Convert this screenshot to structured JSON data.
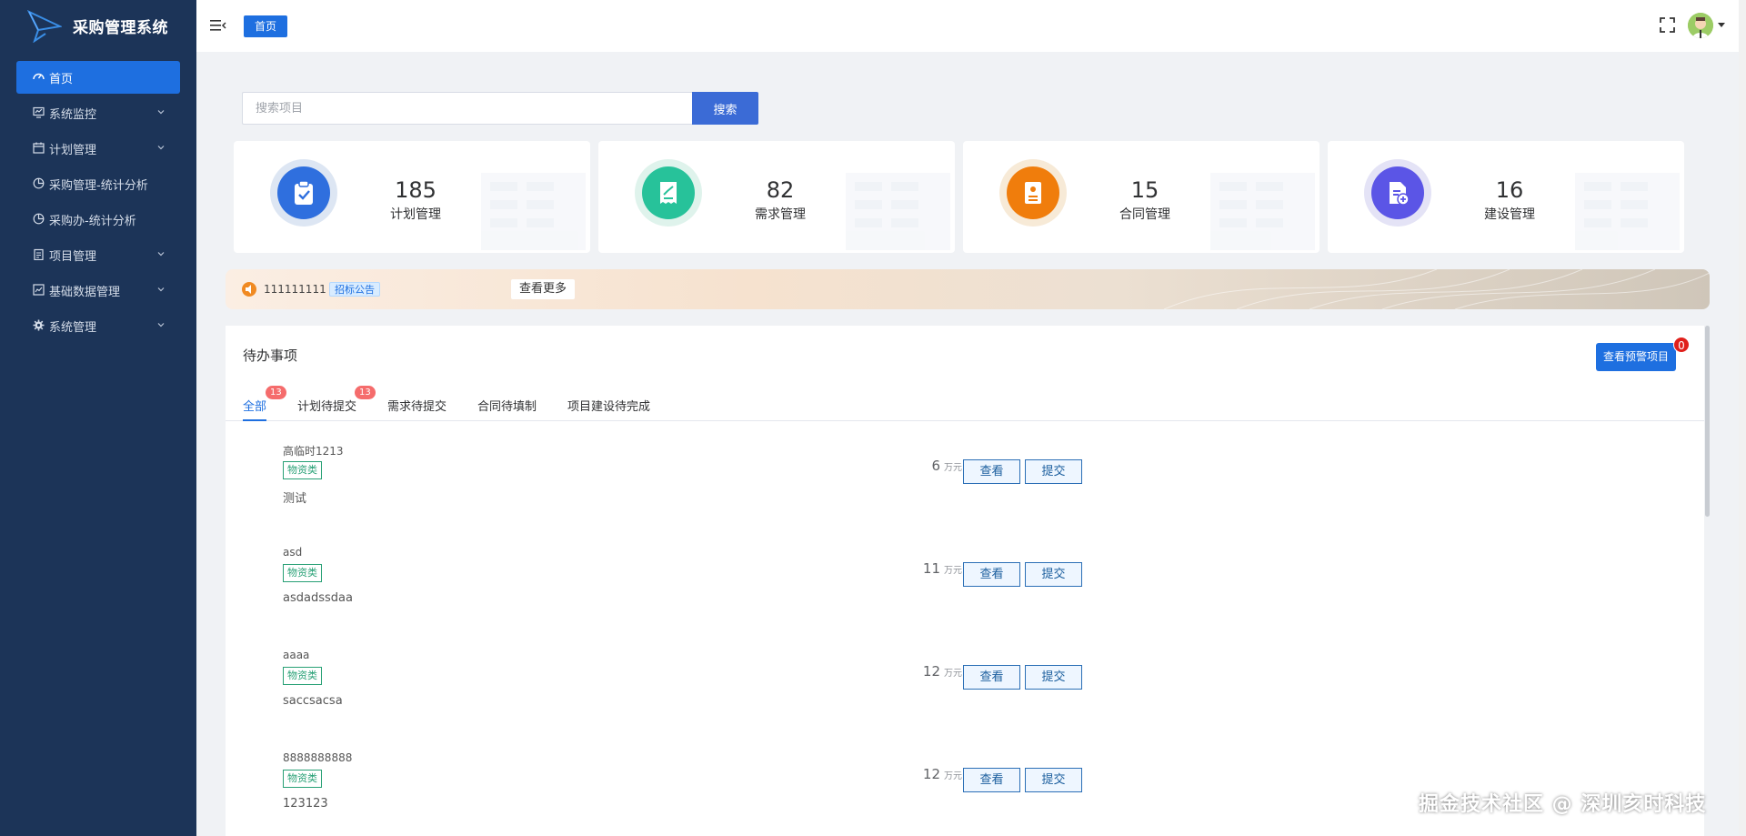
{
  "app": {
    "title": "采购管理系统"
  },
  "sidebar": {
    "items": [
      {
        "label": "首页",
        "icon": "dashboard-icon",
        "active": true,
        "expandable": false
      },
      {
        "label": "系统监控",
        "icon": "monitor-icon",
        "active": false,
        "expandable": true
      },
      {
        "label": "计划管理",
        "icon": "calendar-icon",
        "active": false,
        "expandable": true
      },
      {
        "label": "采购管理-统计分析",
        "icon": "chart-icon",
        "active": false,
        "expandable": false
      },
      {
        "label": "采购办-统计分析",
        "icon": "chart-icon",
        "active": false,
        "expandable": false
      },
      {
        "label": "项目管理",
        "icon": "clipboard-icon",
        "active": false,
        "expandable": true
      },
      {
        "label": "基础数据管理",
        "icon": "database-icon",
        "active": false,
        "expandable": true
      },
      {
        "label": "系统管理",
        "icon": "gear-icon",
        "active": false,
        "expandable": true
      }
    ]
  },
  "topbar": {
    "home_tag": "首页"
  },
  "search": {
    "placeholder": "搜索项目",
    "button_label": "搜索"
  },
  "stats": [
    {
      "value": "185",
      "label": "计划管理",
      "color": "#2f6fde",
      "ring": "#dde6f3",
      "icon": "clipboard-check-icon"
    },
    {
      "value": "82",
      "label": "需求管理",
      "color": "#27c29a",
      "ring": "#dff3ec",
      "icon": "receipt-icon"
    },
    {
      "value": "15",
      "label": "合同管理",
      "color": "#f07d0c",
      "ring": "#f7ead7",
      "icon": "contract-icon"
    },
    {
      "value": "16",
      "label": "建设管理",
      "color": "#5b55e6",
      "ring": "#e4e3f6",
      "icon": "file-add-icon"
    }
  ],
  "notice": {
    "text": "111111111",
    "badge": "招标公告",
    "more_label": "查看更多"
  },
  "todo": {
    "title": "待办事项",
    "warn_button": "查看预警项目",
    "warn_count": "0",
    "tabs": [
      {
        "label": "全部",
        "badge": "13",
        "active": true
      },
      {
        "label": "计划待提交",
        "badge": "13",
        "active": false
      },
      {
        "label": "需求待提交",
        "badge": "",
        "active": false
      },
      {
        "label": "合同待填制",
        "badge": "",
        "active": false
      },
      {
        "label": "项目建设待完成",
        "badge": "",
        "active": false
      }
    ],
    "rows": [
      {
        "name": "高临时1213",
        "tag": "物资类",
        "desc": "测试",
        "amount": "6",
        "unit": "万元",
        "view": "查看",
        "submit": "提交"
      },
      {
        "name": "asd",
        "tag": "物资类",
        "desc": "asdadssdaa",
        "amount": "11",
        "unit": "万元",
        "view": "查看",
        "submit": "提交"
      },
      {
        "name": "aaaa",
        "tag": "物资类",
        "desc": "saccsacsa",
        "amount": "12",
        "unit": "万元",
        "view": "查看",
        "submit": "提交"
      },
      {
        "name": "8888888888",
        "tag": "物资类",
        "desc": "123123",
        "amount": "12",
        "unit": "万元",
        "view": "查看",
        "submit": "提交"
      }
    ]
  },
  "watermark": "掘金技术社区 @ 深圳亥时科技"
}
